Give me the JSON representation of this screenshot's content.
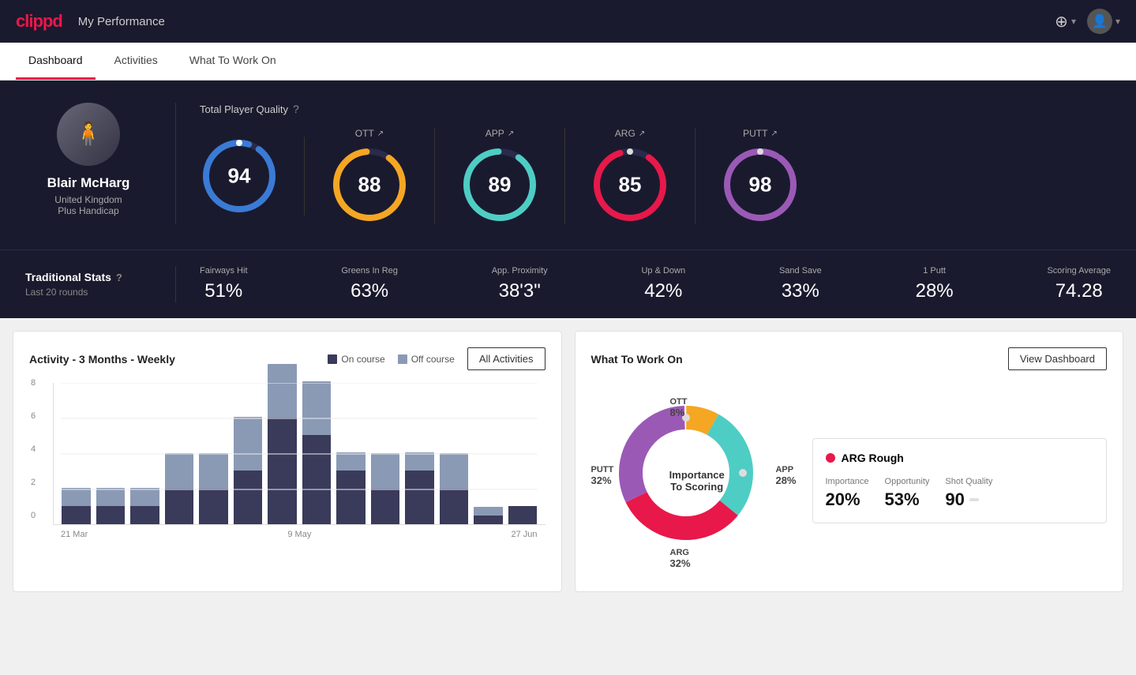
{
  "app": {
    "logo": "clippd",
    "nav_title": "My Performance",
    "add_icon": "⊕",
    "user_icon": "👤"
  },
  "tabs": [
    {
      "id": "dashboard",
      "label": "Dashboard",
      "active": true
    },
    {
      "id": "activities",
      "label": "Activities",
      "active": false
    },
    {
      "id": "what-to-work-on",
      "label": "What To Work On",
      "active": false
    }
  ],
  "player": {
    "name": "Blair McHarg",
    "country": "United Kingdom",
    "handicap": "Plus Handicap"
  },
  "tpq": {
    "label": "Total Player Quality",
    "scores": [
      {
        "label": "94",
        "color": "#3a7bd5",
        "value": 94,
        "max": 100,
        "category": "TPQ"
      },
      {
        "label": "OTT",
        "value": 88,
        "color": "#f5a623"
      },
      {
        "label": "APP",
        "value": 89,
        "color": "#4ecdc4"
      },
      {
        "label": "ARG",
        "value": 85,
        "color": "#e8184a"
      },
      {
        "label": "PUTT",
        "value": 98,
        "color": "#9b59b6"
      }
    ]
  },
  "traditional_stats": {
    "label": "Traditional Stats",
    "sublabel": "Last 20 rounds",
    "stats": [
      {
        "label": "Fairways Hit",
        "value": "51%"
      },
      {
        "label": "Greens In Reg",
        "value": "63%"
      },
      {
        "label": "App. Proximity",
        "value": "38'3\""
      },
      {
        "label": "Up & Down",
        "value": "42%"
      },
      {
        "label": "Sand Save",
        "value": "33%"
      },
      {
        "label": "1 Putt",
        "value": "28%"
      },
      {
        "label": "Scoring Average",
        "value": "74.28"
      }
    ]
  },
  "activity_chart": {
    "title": "Activity - 3 Months - Weekly",
    "legend": [
      {
        "label": "On course",
        "color": "#3a3a5a"
      },
      {
        "label": "Off course",
        "color": "#8a9ab5"
      }
    ],
    "button_label": "All Activities",
    "y_labels": [
      "8",
      "6",
      "4",
      "2",
      "0"
    ],
    "x_labels": [
      "21 Mar",
      "9 May",
      "27 Jun"
    ],
    "bars": [
      {
        "on": 1,
        "off": 1
      },
      {
        "on": 1,
        "off": 1
      },
      {
        "on": 1,
        "off": 1
      },
      {
        "on": 2,
        "off": 2
      },
      {
        "on": 2,
        "off": 2
      },
      {
        "on": 3,
        "off": 3
      },
      {
        "on": 6,
        "off": 3
      },
      {
        "on": 5,
        "off": 3
      },
      {
        "on": 3,
        "off": 1
      },
      {
        "on": 2,
        "off": 2
      },
      {
        "on": 3,
        "off": 1
      },
      {
        "on": 2,
        "off": 2
      },
      {
        "on": 0.5,
        "off": 0.5
      },
      {
        "on": 1,
        "off": 0
      }
    ]
  },
  "what_to_work_on": {
    "title": "What To Work On",
    "button_label": "View Dashboard",
    "donut": {
      "center_line1": "Importance",
      "center_line2": "To Scoring",
      "segments": [
        {
          "label": "OTT",
          "value": 8,
          "color": "#f5a623",
          "percent": "8%"
        },
        {
          "label": "APP",
          "value": 28,
          "color": "#4ecdc4",
          "percent": "28%"
        },
        {
          "label": "ARG",
          "value": 32,
          "color": "#e8184a",
          "percent": "32%"
        },
        {
          "label": "PUTT",
          "value": 32,
          "color": "#9b59b6",
          "percent": "32%"
        }
      ]
    },
    "detail_card": {
      "title": "ARG Rough",
      "dot_color": "#e8184a",
      "metrics": [
        {
          "label": "Importance",
          "value": "20%"
        },
        {
          "label": "Opportunity",
          "value": "53%"
        },
        {
          "label": "Shot Quality",
          "value": "90",
          "badge": ""
        }
      ]
    }
  }
}
